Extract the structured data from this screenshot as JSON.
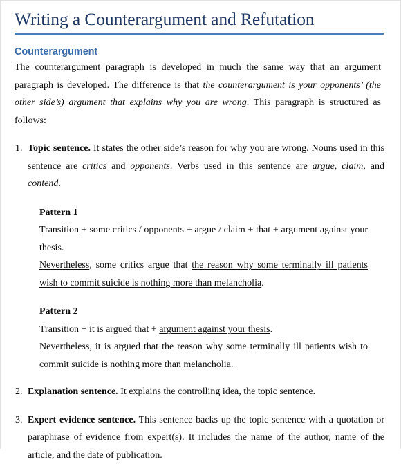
{
  "document": {
    "title": "Writing a Counterargument and Refutation",
    "section_heading": "Counterargument",
    "intro": {
      "part1": "The counterargument paragraph is developed in much the same way that an argument paragraph is developed. The difference is that ",
      "italic": "the counterargument is your opponents’ (the other side’s) argument that explains why you are wrong",
      "part2": ". This paragraph is structured as follows:"
    },
    "list": [
      {
        "marker": "1.",
        "lead": "Topic sentence.",
        "text_a": " It states the other side’s reason for why you are wrong. Nouns used in this sentence are ",
        "italic_a": "critics",
        "text_b": " and ",
        "italic_b": "opponents",
        "text_c": ". Verbs used in this sentence are ",
        "italic_c": "argue, claim,",
        "text_d": " and ",
        "italic_d": "contend",
        "text_e": "."
      },
      {
        "marker": "2.",
        "lead": "Explanation sentence.",
        "text_a": " It explains the controlling idea, the topic sentence."
      },
      {
        "marker": "3.",
        "lead": "Expert evidence sentence.",
        "text_a": " This sentence backs up the topic sentence with a quotation or paraphrase of evidence from expert(s). It includes the name of the author, name of the article, and the date of publication."
      }
    ],
    "patterns": [
      {
        "title": "Pattern 1",
        "formula": {
          "underlined_1": "Transition",
          "plain_1": " + some critics / opponents + argue / claim + that + ",
          "underlined_2": "argument against your thesis",
          "plain_2": "."
        },
        "example": {
          "underlined_1": "Nevertheless",
          "plain_1": ", some critics argue that ",
          "underlined_2": "the reason why some terminally ill patients wish to commit suicide is nothing more than melancholia",
          "plain_2": "."
        }
      },
      {
        "title": "Pattern 2",
        "formula": {
          "underlined_1": "",
          "plain_1": "Transition + it is argued that + ",
          "underlined_2": "argument against your thesis",
          "plain_2": "."
        },
        "example": {
          "underlined_1": "Nevertheless",
          "plain_1": ", it is argued that ",
          "underlined_2": "the reason why some terminally ill patients wish to commit suicide is nothing more than melancholia.",
          "plain_2": ""
        }
      }
    ],
    "colors": {
      "title": "#1f3864",
      "rule": "#4a7ebb",
      "heading": "#3c6ca8",
      "body": "#0d0d0d",
      "page_border": "#e2e2e2"
    }
  }
}
